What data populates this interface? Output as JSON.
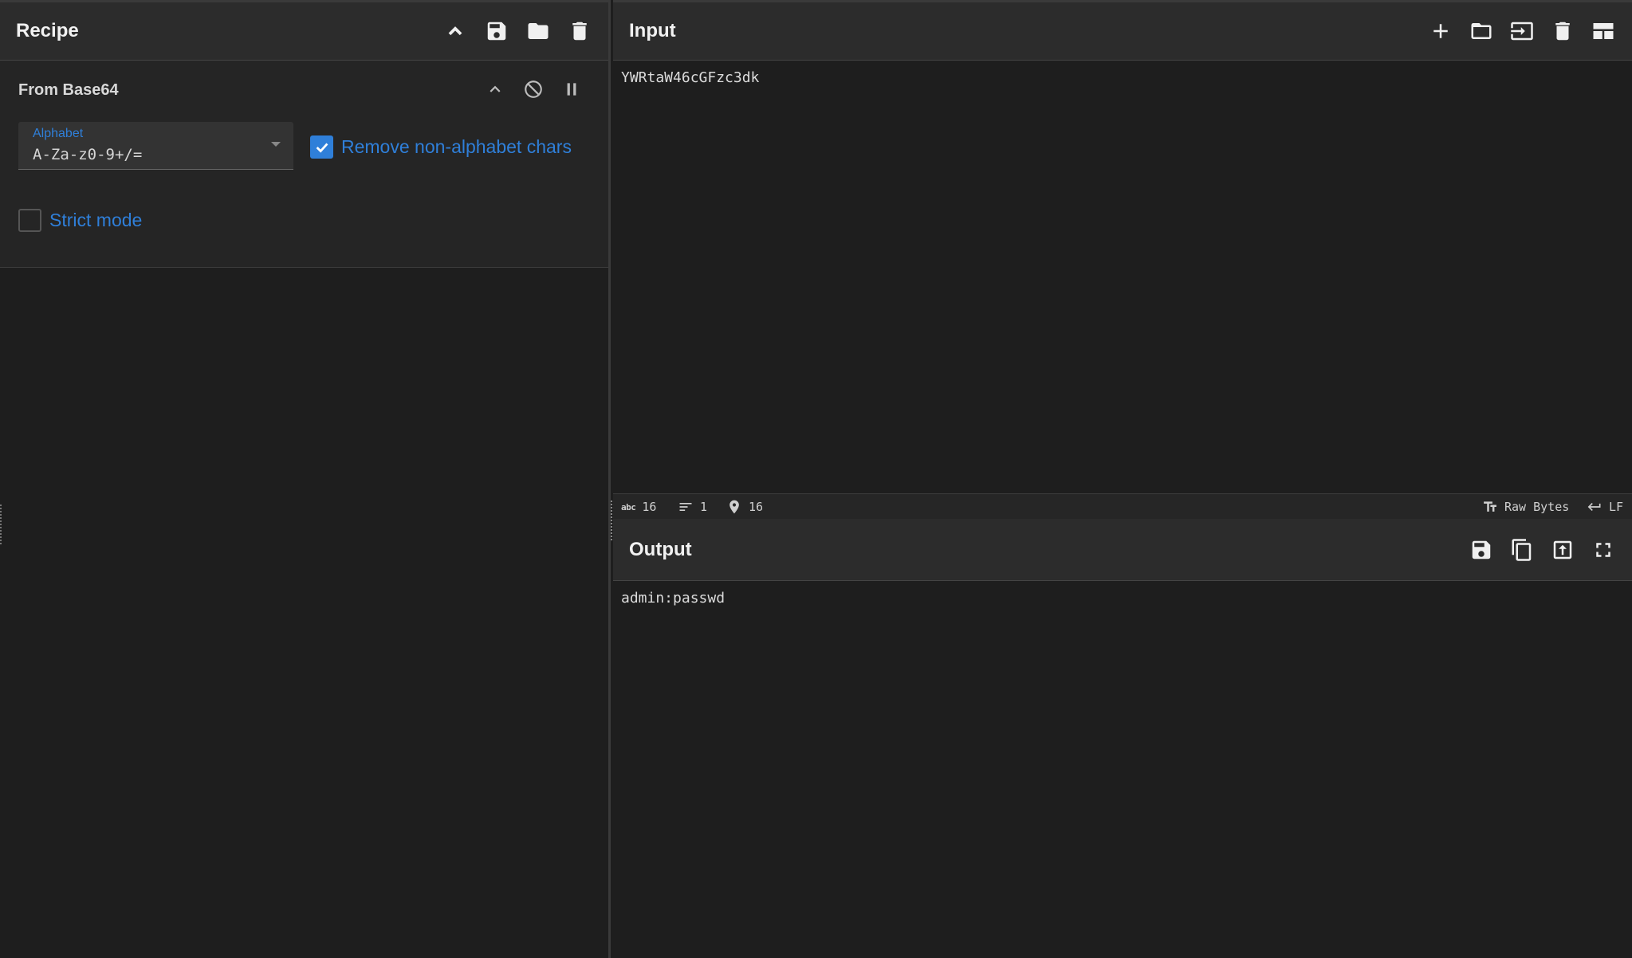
{
  "recipe": {
    "title": "Recipe",
    "operation": {
      "title": "From Base64",
      "alphabet": {
        "label": "Alphabet",
        "value": "A-Za-z0-9+/="
      },
      "remove_non_alphabet": {
        "label": "Remove non-alphabet chars",
        "checked": true
      },
      "strict_mode": {
        "label": "Strict mode",
        "checked": false
      }
    }
  },
  "input": {
    "title": "Input",
    "text": "YWRtaW46cGFzc3dk",
    "status": {
      "length": "16",
      "lines": "1",
      "position": "16",
      "abc_icon_label": "abc",
      "encoding": "Raw Bytes",
      "eol": "LF"
    }
  },
  "output": {
    "title": "Output",
    "text": "admin:passwd"
  },
  "colors": {
    "accent": "#2f7fd9",
    "background": "#1e1e1e",
    "header": "#2c2c2c"
  }
}
